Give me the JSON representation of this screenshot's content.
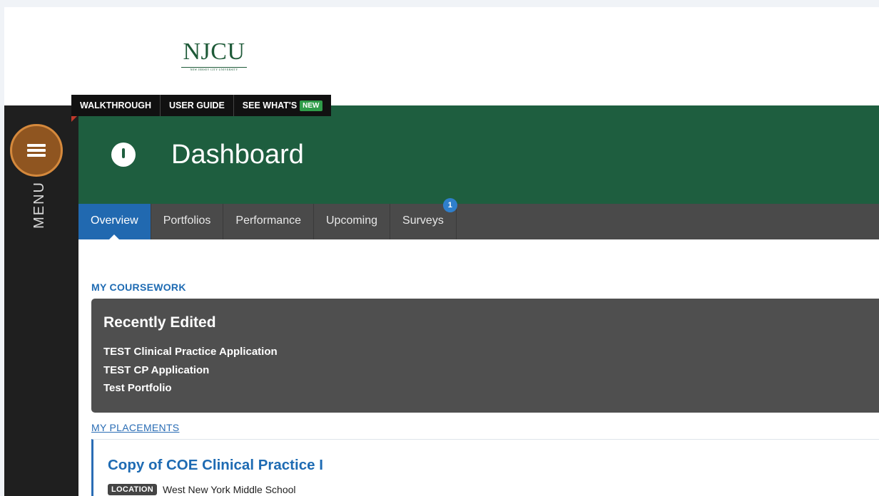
{
  "logo": {
    "word": "NJCU",
    "sub": "NEW JERSEY CITY UNIVERSITY"
  },
  "helpbar": {
    "walkthrough": "WALKTHROUGH",
    "user_guide": "USER GUIDE",
    "see_whats": "SEE WHAT'S",
    "new_badge": "NEW"
  },
  "sidebar": {
    "menu_label": "MENU"
  },
  "header": {
    "title": "Dashboard"
  },
  "tabs": [
    {
      "label": "Overview"
    },
    {
      "label": "Portfolios"
    },
    {
      "label": "Performance"
    },
    {
      "label": "Upcoming"
    },
    {
      "label": "Surveys",
      "badge": "1"
    }
  ],
  "coursework": {
    "section_title": "MY COURSEWORK",
    "recent_title": "Recently Edited",
    "items": [
      "TEST Clinical Practice Application",
      "TEST CP Application",
      "Test Portfolio"
    ]
  },
  "placements": {
    "link": "MY PLACEMENTS",
    "title": "Copy of COE Clinical Practice I",
    "location_label": "LOCATION",
    "location": "West New York Middle School"
  }
}
